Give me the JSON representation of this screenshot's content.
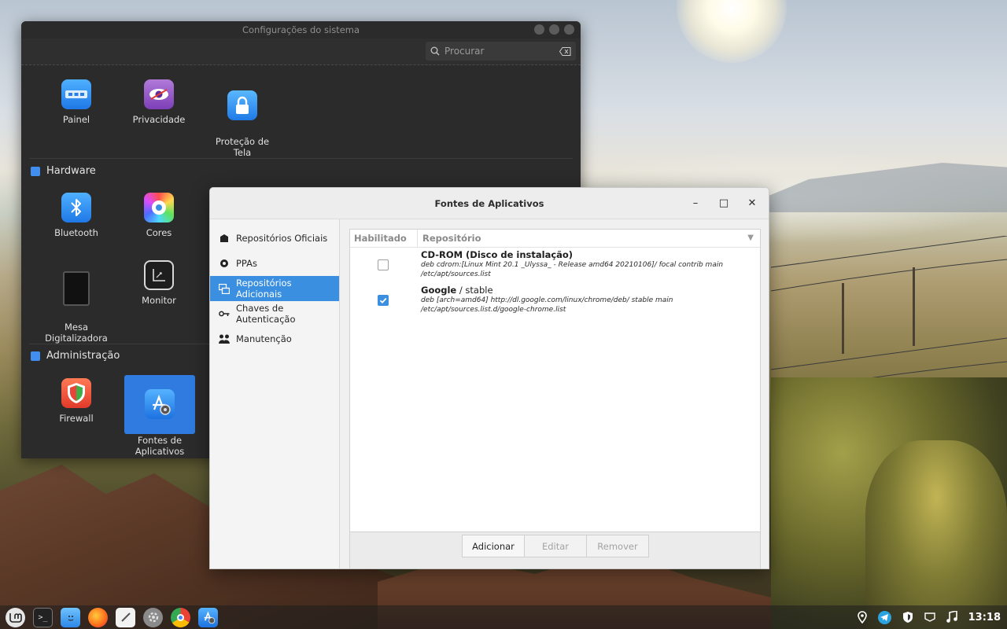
{
  "settings_window": {
    "title": "Configurações do sistema",
    "search": {
      "placeholder": "Procurar"
    },
    "top_items": [
      {
        "label": "Painel",
        "icon": "panel-icon"
      },
      {
        "label": "Privacidade",
        "icon": "privacy-eye-icon"
      },
      {
        "label": "Proteção de\nTela",
        "icon": "screensaver-lock-icon"
      }
    ],
    "hardware": {
      "title": "Hardware",
      "items": [
        {
          "label": "Bluetooth",
          "icon": "bluetooth-icon"
        },
        {
          "label": "Cores",
          "icon": "color-wheel-icon"
        },
        {
          "label": "Mesa\nDigitalizadora",
          "icon": "tablet-icon"
        },
        {
          "label": "Monitor",
          "icon": "monitor-icon"
        }
      ]
    },
    "admin": {
      "title": "Administração",
      "items": [
        {
          "label": "Firewall",
          "icon": "firewall-shield-icon"
        },
        {
          "label": "Fontes de\nAplicativos",
          "icon": "software-sources-icon"
        }
      ]
    }
  },
  "dialog": {
    "title": "Fontes de Aplicativos",
    "sidebar": [
      {
        "label": "Repositórios Oficiais",
        "icon": "package-icon",
        "active": false
      },
      {
        "label": "PPAs",
        "icon": "ppa-icon",
        "active": false
      },
      {
        "label": "Repositórios Adicionais",
        "icon": "additional-repos-icon",
        "active": true
      },
      {
        "label": "Chaves de Autenticação",
        "icon": "key-icon",
        "active": false
      },
      {
        "label": "Manutenção",
        "icon": "maintenance-icon",
        "active": false
      }
    ],
    "table": {
      "columns": [
        "Habilitado",
        "Repositório"
      ],
      "rows": [
        {
          "enabled": false,
          "name_bold": "CD-ROM (Disco de instalação)",
          "name_rest": "",
          "line1": "deb cdrom:[Linux Mint 20.1 _Ulyssa_ - Release amd64 20210106]/ focal contrib main",
          "line2": "/etc/apt/sources.list"
        },
        {
          "enabled": true,
          "name_bold": "Google",
          "name_rest": " / stable",
          "line1": "deb [arch=amd64] http://dl.google.com/linux/chrome/deb/ stable main",
          "line2": "/etc/apt/sources.list.d/google-chrome.list"
        }
      ]
    },
    "buttons": {
      "add": "Adicionar",
      "edit": "Editar",
      "remove": "Remover"
    }
  },
  "taskbar": {
    "apps": [
      "mint-menu-icon",
      "terminal-icon",
      "files-icon",
      "firefox-icon",
      "text-editor-icon",
      "settings-icon",
      "chrome-icon",
      "software-sources-icon"
    ],
    "clock": "13:18"
  },
  "colors": {
    "accent": "#3b8fe0",
    "settings_bg": "#2b2b2b",
    "selected": "#2f7be0"
  }
}
